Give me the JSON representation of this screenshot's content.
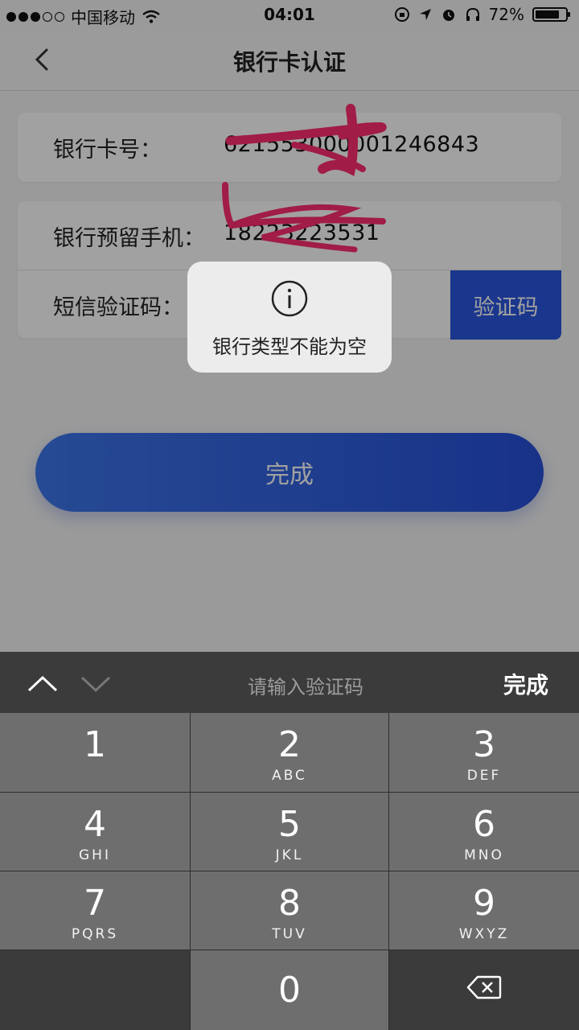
{
  "status_bar": {
    "carrier": "中国移动",
    "time": "04:01",
    "battery": "72%"
  },
  "nav": {
    "title": "银行卡认证",
    "back_icon": "chevron-left-icon"
  },
  "form": {
    "card_number_label": "银行卡号：",
    "card_number_value": "621553000001246843",
    "phone_label": "银行预留手机：",
    "phone_value": "18223223531",
    "sms_label": "短信验证码：",
    "sms_value": "",
    "sms_button": "验证码"
  },
  "submit_label": "完成",
  "toast": {
    "icon": "info-icon",
    "message": "银行类型不能为空"
  },
  "keyboard": {
    "placeholder": "请输入验证码",
    "done_label": "完成",
    "keys": [
      {
        "num": "1",
        "letters": ""
      },
      {
        "num": "2",
        "letters": "ABC"
      },
      {
        "num": "3",
        "letters": "DEF"
      },
      {
        "num": "4",
        "letters": "GHI"
      },
      {
        "num": "5",
        "letters": "JKL"
      },
      {
        "num": "6",
        "letters": "MNO"
      },
      {
        "num": "7",
        "letters": "PQRS"
      },
      {
        "num": "8",
        "letters": "TUV"
      },
      {
        "num": "9",
        "letters": "WXYZ"
      },
      {
        "num": "0",
        "letters": ""
      }
    ]
  },
  "colors": {
    "accent": "#2a56e0",
    "annotation": "#ff2d6f"
  }
}
